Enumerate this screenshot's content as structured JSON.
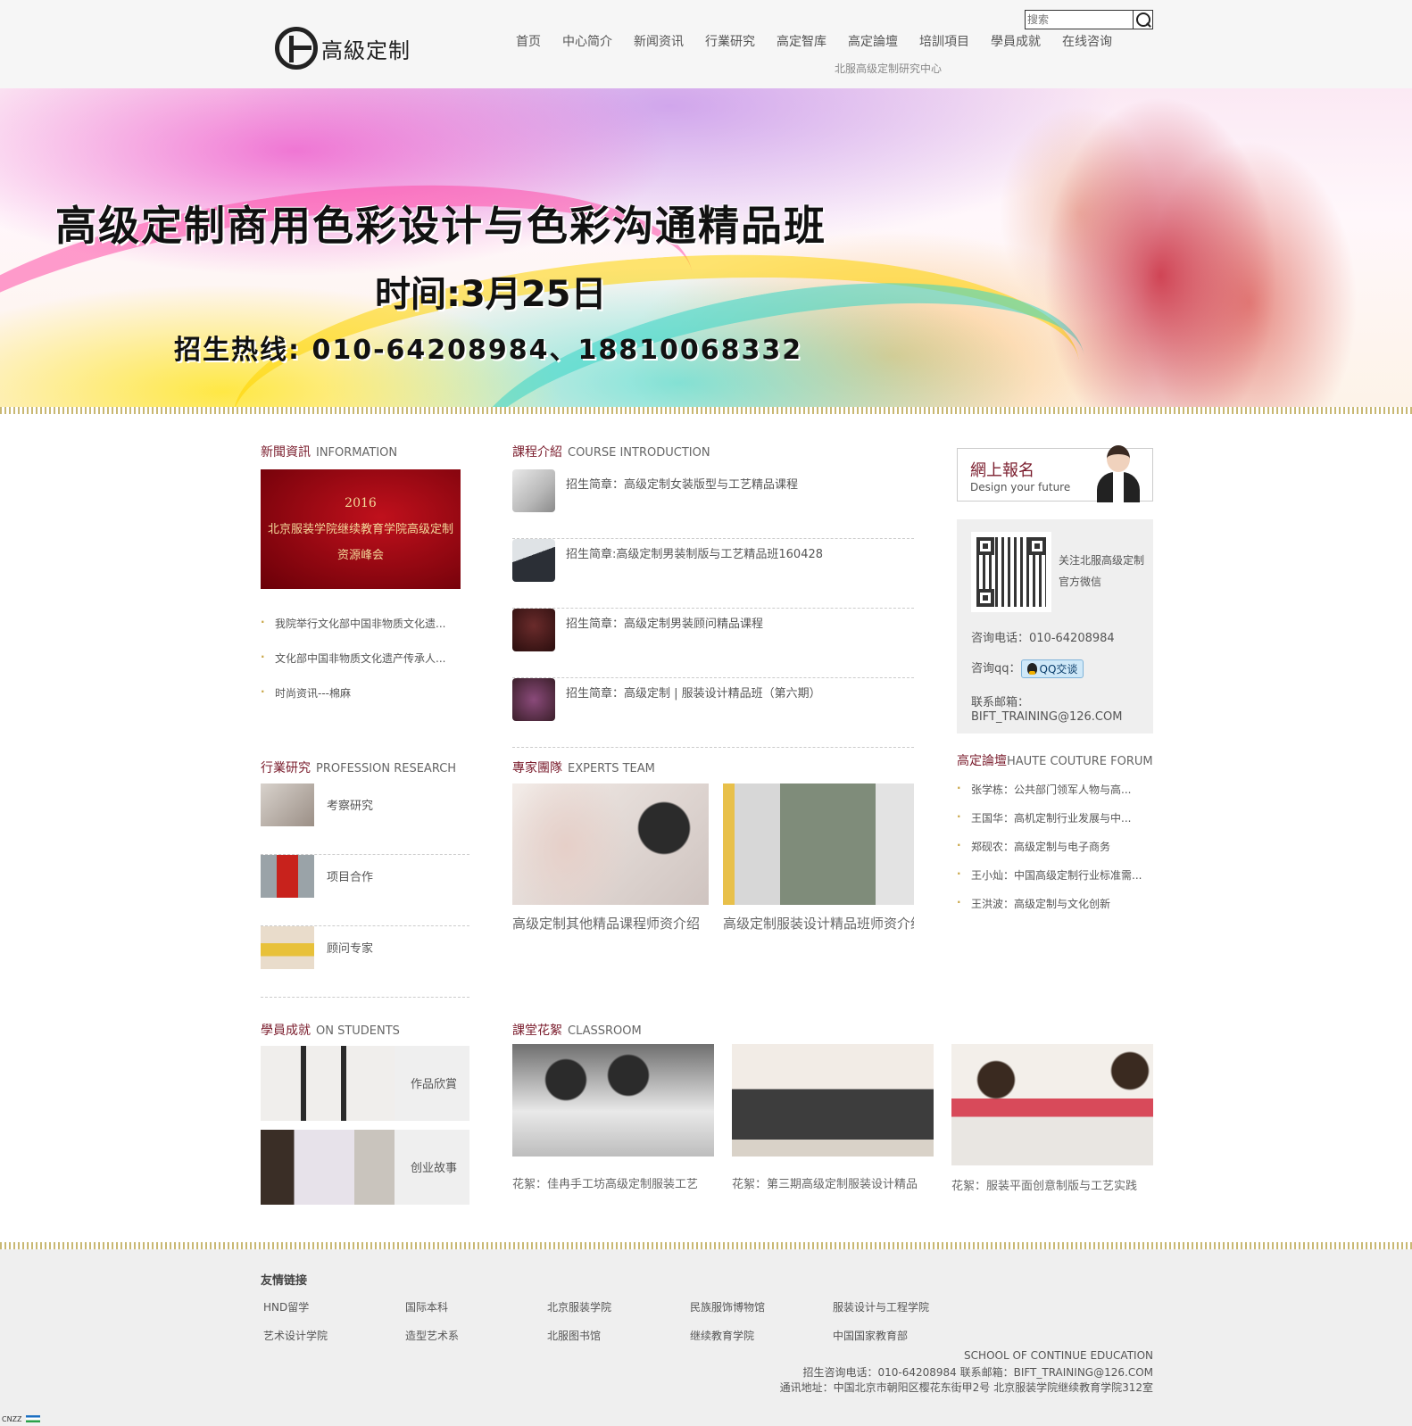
{
  "header": {
    "logo_text": "高級定制",
    "search_placeholder": "搜索",
    "subtitle": "北服高级定制研究中心",
    "nav": [
      "首页",
      "中心简介",
      "新闻资讯",
      "行業研究",
      "高定智库",
      "高定論壇",
      "培訓項目",
      "學員成就",
      "在线咨询"
    ]
  },
  "banner": {
    "title": "高级定制商用色彩设计与色彩沟通精品班",
    "time": "时间:3月25日",
    "hotline": "招生热线: 010-64208984、18810068332"
  },
  "news": {
    "title_cn": "新聞資訊",
    "title_en": "INFORMATION",
    "image_year": "2016",
    "image_line1": "北京服装学院继续教育学院高级定制",
    "image_line2": "资源峰会",
    "items": [
      "我院举行文化部中国非物质文化遗...",
      "文化部中国非物质文化遗产传承人...",
      "时尚资讯---棉麻"
    ]
  },
  "course": {
    "title_cn": "課程介紹",
    "title_en": "COURSE INTRODUCTION",
    "items": [
      "招生简章：高级定制女装版型与工艺精品课程",
      "招生简章:高级定制男装制版与工艺精品班160428",
      "招生简章：高级定制男装顾问精品课程",
      "招生简章：高级定制 | 服装设计精品班（第六期）"
    ]
  },
  "signup": {
    "title": "網上報名",
    "subtitle": "Design your future"
  },
  "contact": {
    "follow": "关注北服高级定制官方微信",
    "phone": "咨询电话：010-64208984",
    "qq_label": "咨询qq：",
    "qq_button": "QQ交谈",
    "email_label": "联系邮箱：",
    "email": "BIFT_TRAINING@126.COM"
  },
  "forum": {
    "title_cn": "高定論壇",
    "title_en": "HAUTE COUTURE FORUM",
    "items": [
      "张学栋：公共部门领军人物与高...",
      "王国华：高机定制行业发展与中...",
      "郑砚农：高级定制与电子商务",
      "王小灿：中国高级定制行业标准需...",
      "王洪波：高级定制与文化创新"
    ]
  },
  "research": {
    "title_cn": "行業研究",
    "title_en": "PROFESSION RESEARCH",
    "items": [
      "考察研究",
      "项目合作",
      "顾问专家"
    ]
  },
  "experts": {
    "title_cn": "專家團隊",
    "title_en": "EXPERTS TEAM",
    "items": [
      "高级定制其他精品课程师资介绍",
      "高级定制服装设计精品班师资介绍"
    ]
  },
  "students": {
    "title_cn": "學員成就",
    "title_en": "ON STUDENTS",
    "items": [
      "作品欣賞",
      "创业故事"
    ]
  },
  "classroom": {
    "title_cn": "課堂花絮",
    "title_en": "CLASSROOM",
    "items": [
      "花絮：佳冉手工坊高级定制服装工艺",
      "花絮：第三期高级定制服装设计精品",
      "花絮：服装平面创意制版与工艺实践"
    ]
  },
  "footer": {
    "friend_title": "友情链接",
    "links": [
      "HND留学",
      "国际本科",
      "北京服装学院",
      "民族服饰博物馆",
      "服装设计与工程学院",
      "艺术设计学院",
      "造型艺术系",
      "北服图书馆",
      "继续教育学院",
      "中国国家教育部"
    ],
    "school": "SCHOOL OF CONTINUE EDUCATION",
    "contact": "招生咨询电话：010-64208984 联系邮箱：BIFT_TRAINING@126.COM",
    "address": "通讯地址：中国北京市朝阳区樱花东街甲2号 北京服装学院继续教育学院312室"
  },
  "cnzz": "CNZZ"
}
